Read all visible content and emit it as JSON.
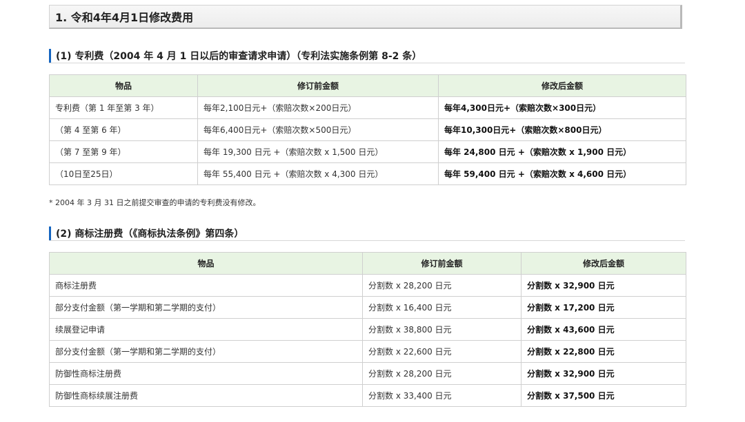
{
  "page": {
    "title": "1. 令和4年4月1日修改费用"
  },
  "section1": {
    "title": "(1) 专利费（2004 年 4 月 1 日以后的审查请求申请）（专利法实施条例第 8-2 条）",
    "headers": [
      "物品",
      "修订前金额",
      "修改后金额"
    ],
    "rows": [
      {
        "item": "专利费（第 1 年至第 3 年）",
        "before": "每年2,100日元+（索赔次数×200日元）",
        "after": "每年4,300日元+（索赔次数×300日元）"
      },
      {
        "item": "（第 4 至第 6 年）",
        "before": "每年6,400日元+（索赔次数×500日元）",
        "after": "每年10,300日元+（索赔次数×800日元）"
      },
      {
        "item": "（第 7 至第 9 年）",
        "before": "每年 19,300 日元 +（索赔次数 x 1,500 日元）",
        "after": "每年 24,800 日元 +（索赔次数 x 1,900 日元）"
      },
      {
        "item": "（10日至25日）",
        "before": "每年 55,400 日元 +（索赔次数 x 4,300 日元）",
        "after": "每年 59,400 日元 +（索赔次数 x 4,600 日元）"
      }
    ],
    "note": "* 2004 年 3 月 31 日之前提交审查的申请的专利费没有修改。"
  },
  "section2": {
    "title": "(2) 商标注册费（《商标执法条例》第四条）",
    "headers": [
      "物品",
      "修订前金额",
      "修改后金额"
    ],
    "rows": [
      {
        "item": "商标注册费",
        "before": "分割数 x 28,200 日元",
        "after": "分割数 x 32,900 日元"
      },
      {
        "item": "部分支付金额（第一学期和第二学期的支付）",
        "before": "分割数 x 16,400 日元",
        "after": "分割数 x 17,200 日元"
      },
      {
        "item": "续展登记申请",
        "before": "分割数 x 38,800 日元",
        "after": "分割数 x 43,600 日元"
      },
      {
        "item": "部分支付金额（第一学期和第二学期的支付）",
        "before": "分割数 x 22,600 日元",
        "after": "分割数 x 22,800 日元"
      },
      {
        "item": "防御性商标注册费",
        "before": "分割数 x 28,200 日元",
        "after": "分割数 x 32,900 日元"
      },
      {
        "item": "防御性商标续展注册费",
        "before": "分割数 x 33,400 日元",
        "after": "分割数 x 37,500 日元"
      }
    ]
  }
}
